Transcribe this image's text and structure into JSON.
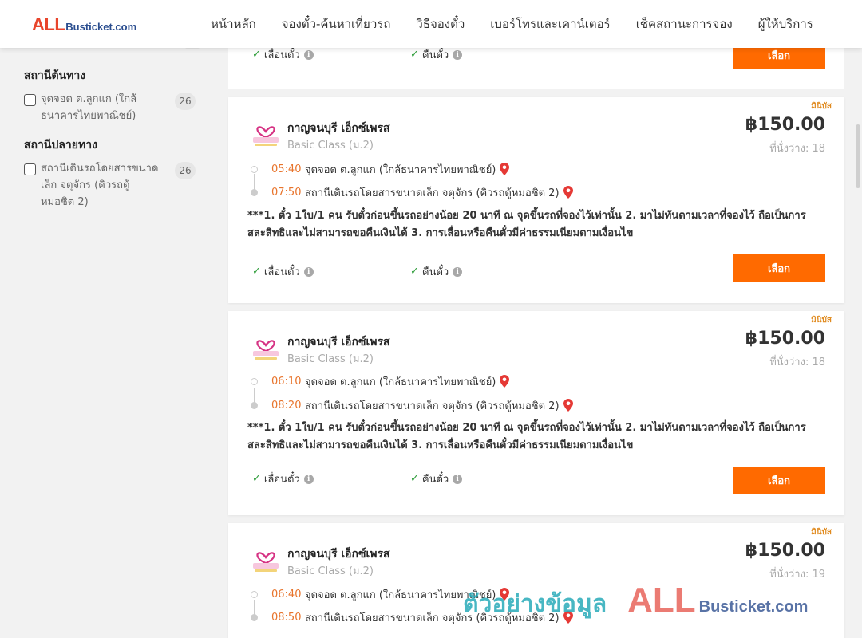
{
  "header": {
    "logo_all": "ALL",
    "logo_rest": "Busticket.com",
    "nav": [
      "หน้าหลัก",
      "จองตั๋ว-ค้นหาเที่ยวรถ",
      "วิธีจองตั๋ว",
      "เบอร์โทรและเคาน์เตอร์",
      "เช็คสถานะการจอง",
      "ผู้ให้บริการ"
    ]
  },
  "sidebar": {
    "origin": {
      "title": "สถานีต้นทาง",
      "label": "จุดจอด ต.ลูกแก (ใกล้ธนาคารไทยพาณิชย์)",
      "count": "26"
    },
    "destination": {
      "title": "สถานีปลายทาง",
      "label": "สถานีเดินรถโดยสารขนาดเล็ก จตุจักร (คิวรถตู้หมอชิต 2)",
      "count": "26"
    }
  },
  "top_card": {
    "reschedule": "เลื่อนตั๋ว",
    "refund": "คืนตั๋ว",
    "select": "เลือก"
  },
  "cards": [
    {
      "badge": "มินิบัส",
      "operator": "กาญจนบุรี เอ็กซ์เพรส",
      "class": "Basic Class (ม.2)",
      "price": "฿150.00",
      "seats": "ที่นั่งว่าง: 18",
      "dep_time": "05:40",
      "dep_stop": "จุดจอด ต.ลูกแก (ใกล้ธนาคารไทยพาณิชย์)",
      "arr_time": "07:50",
      "arr_stop": "สถานีเดินรถโดยสารขนาดเล็ก จตุจักร (คิวรถตู้หมอชิต 2)",
      "desc": "***1. ตั๋ว 1ใบ/1 คน รับตั๋วก่อนขึ้นรถอย่างน้อย 20 นาที ณ จุดขึ้นรถที่จองไว้เท่านั้น 2. มาไม่ทันตามเวลาที่จองไว้ ถือเป็นการสละสิทธิและไม่สามารถขอคืนเงินได้ 3. การเลื่อนหรือคืนตั๋วมีค่าธรรมเนียมตามเงื่อนไข",
      "reschedule": "เลื่อนตั๋ว",
      "refund": "คืนตั๋ว",
      "select": "เลือก"
    },
    {
      "badge": "มินิบัส",
      "operator": "กาญจนบุรี เอ็กซ์เพรส",
      "class": "Basic Class (ม.2)",
      "price": "฿150.00",
      "seats": "ที่นั่งว่าง: 18",
      "dep_time": "06:10",
      "dep_stop": "จุดจอด ต.ลูกแก (ใกล้ธนาคารไทยพาณิชย์)",
      "arr_time": "08:20",
      "arr_stop": "สถานีเดินรถโดยสารขนาดเล็ก จตุจักร (คิวรถตู้หมอชิต 2)",
      "desc": "***1. ตั๋ว 1ใบ/1 คน รับตั๋วก่อนขึ้นรถอย่างน้อย 20 นาที ณ จุดขึ้นรถที่จองไว้เท่านั้น 2. มาไม่ทันตามเวลาที่จองไว้ ถือเป็นการสละสิทธิและไม่สามารถขอคืนเงินได้ 3. การเลื่อนหรือคืนตั๋วมีค่าธรรมเนียมตามเงื่อนไข",
      "reschedule": "เลื่อนตั๋ว",
      "refund": "คืนตั๋ว",
      "select": "เลือก"
    },
    {
      "badge": "มินิบัส",
      "operator": "กาญจนบุรี เอ็กซ์เพรส",
      "class": "Basic Class (ม.2)",
      "price": "฿150.00",
      "seats": "ที่นั่งว่าง: 19",
      "dep_time": "06:40",
      "dep_stop": "จุดจอด ต.ลูกแก (ใกล้ธนาคารไทยพาณิชย์)",
      "arr_time": "08:50",
      "arr_stop": "สถานีเดินรถโดยสารขนาดเล็ก จตุจักร (คิวรถตู้หมอชิต 2)",
      "desc": "",
      "reschedule": "",
      "refund": "",
      "select": ""
    }
  ],
  "watermark": {
    "sample": "ตัวอย่างข้อมูล",
    "all": "ALL",
    "rest": "Busticket.com"
  },
  "colors": {
    "accent": "#ff6a00",
    "time": "#e8742c",
    "check": "#2e9d3a",
    "pin": "#e53935",
    "badge": "#e08a1e"
  }
}
